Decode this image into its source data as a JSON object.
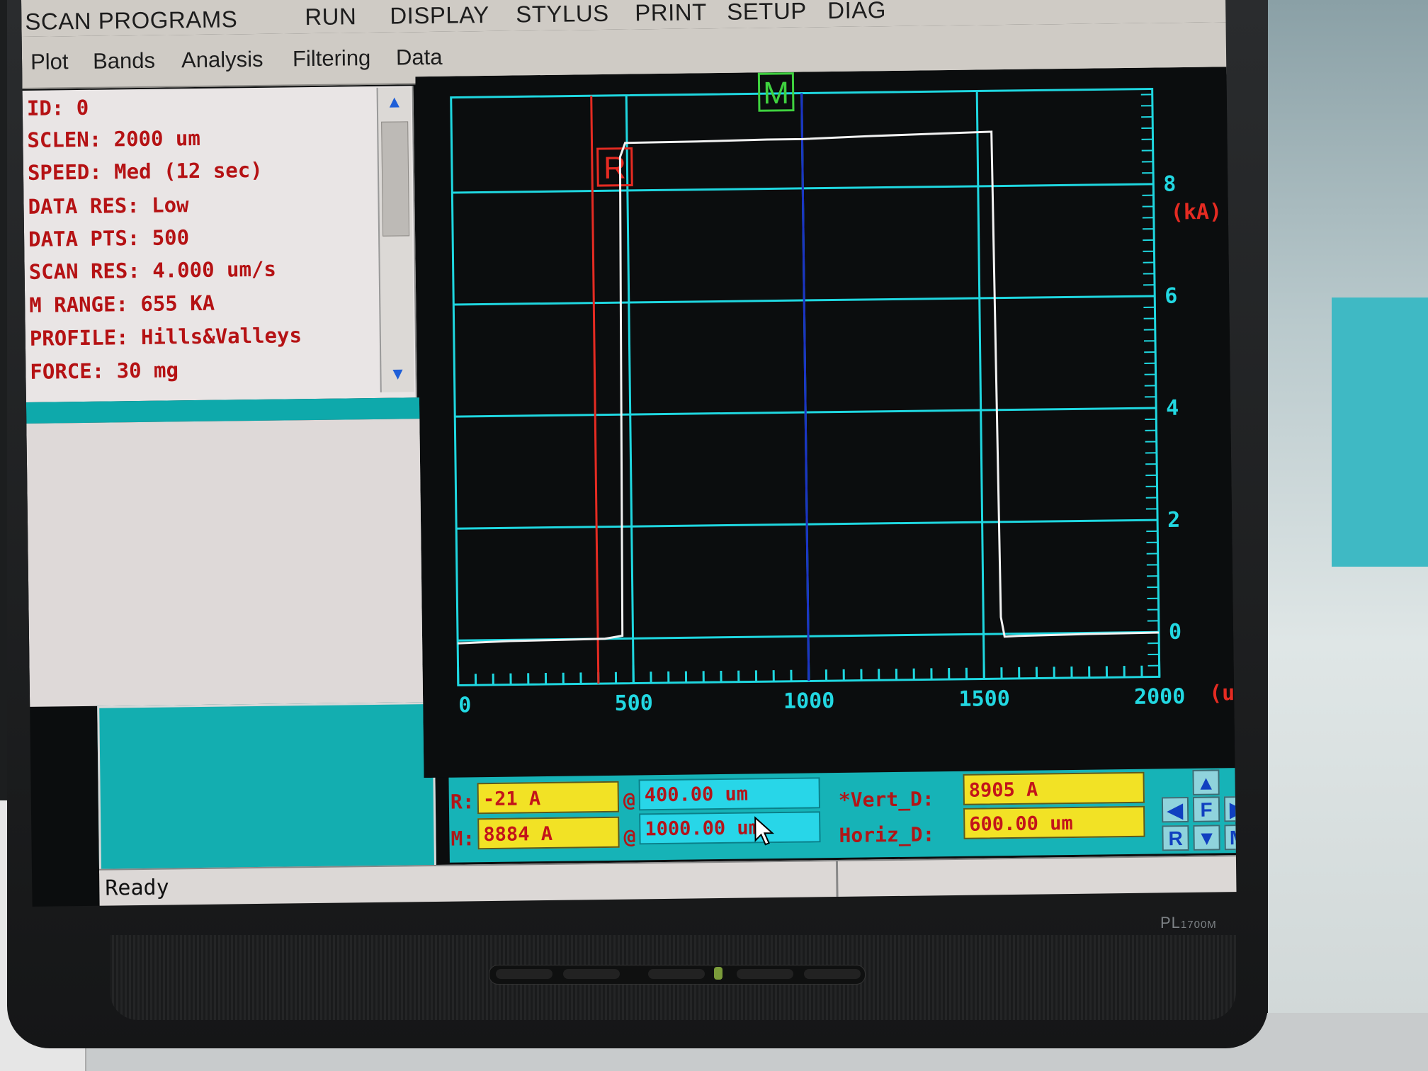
{
  "menu_top": [
    "SCAN PROGRAMS",
    "RUN",
    "DISPLAY",
    "STYLUS",
    "PRINT",
    "SETUP",
    "DIAG"
  ],
  "menu_sub": [
    "Plot",
    "Bands",
    "Analysis",
    "Filtering",
    "Data"
  ],
  "scan_info": [
    "ID: 0",
    "SCLEN: 2000 um",
    "SPEED: Med (12 sec)",
    "DATA RES: Low",
    "DATA PTS: 500",
    "SCAN RES: 4.000 um/s",
    "M RANGE: 655 KA",
    "PROFILE: Hills&Valleys",
    "FORCE: 30 mg"
  ],
  "chart_data": {
    "type": "line",
    "xlabel": "(um)",
    "ylabel": "(kA)",
    "xlim": [
      0,
      2000
    ],
    "ylim": [
      -0.8,
      9.7
    ],
    "x_ticks": [
      0,
      500,
      1000,
      1500,
      2000
    ],
    "y_ticks": [
      0,
      2,
      4,
      6,
      8
    ],
    "grid": true,
    "colors": {
      "background": "#0b0d0e",
      "grid": "#1fd7e0",
      "trace": "#f2f2f2",
      "r_cursor": "#e52b22",
      "m_cursor": "#1b33c4",
      "axis_labels": "#e52b22"
    },
    "series": [
      {
        "x": [
          0,
          150,
          300,
          420,
          470,
          480,
          495,
          700,
          900,
          1000,
          1200,
          1400,
          1540,
          1550,
          1560,
          1600,
          1800,
          2000
        ],
        "y": [
          -0.05,
          -0.02,
          -0.01,
          0.0,
          0.05,
          8.6,
          8.85,
          8.86,
          8.88,
          8.88,
          8.92,
          8.95,
          8.97,
          0.3,
          -0.05,
          -0.04,
          -0.02,
          -0.01
        ]
      }
    ],
    "cursors": [
      {
        "label": "R",
        "x": 400
      },
      {
        "label": "M",
        "x": 1000
      }
    ]
  },
  "readout": {
    "r_label": "R:",
    "r_value": "-21 A",
    "r_at": "@",
    "r_pos": "400.00 um",
    "m_label": "M:",
    "m_value": "8884 A",
    "m_at": "@",
    "m_pos": "1000.00 um",
    "vert_label": "*Vert_D:",
    "vert_value": "8905 A",
    "horiz_label": "Horiz_D:",
    "horiz_value": "600.00 um"
  },
  "nav": {
    "up": "▲",
    "left": "◀",
    "f": "F",
    "right": "▶",
    "r": "R",
    "down": "▼",
    "m": "M"
  },
  "status": "Ready",
  "monitor_brand": "PL",
  "monitor_model": "1700M"
}
